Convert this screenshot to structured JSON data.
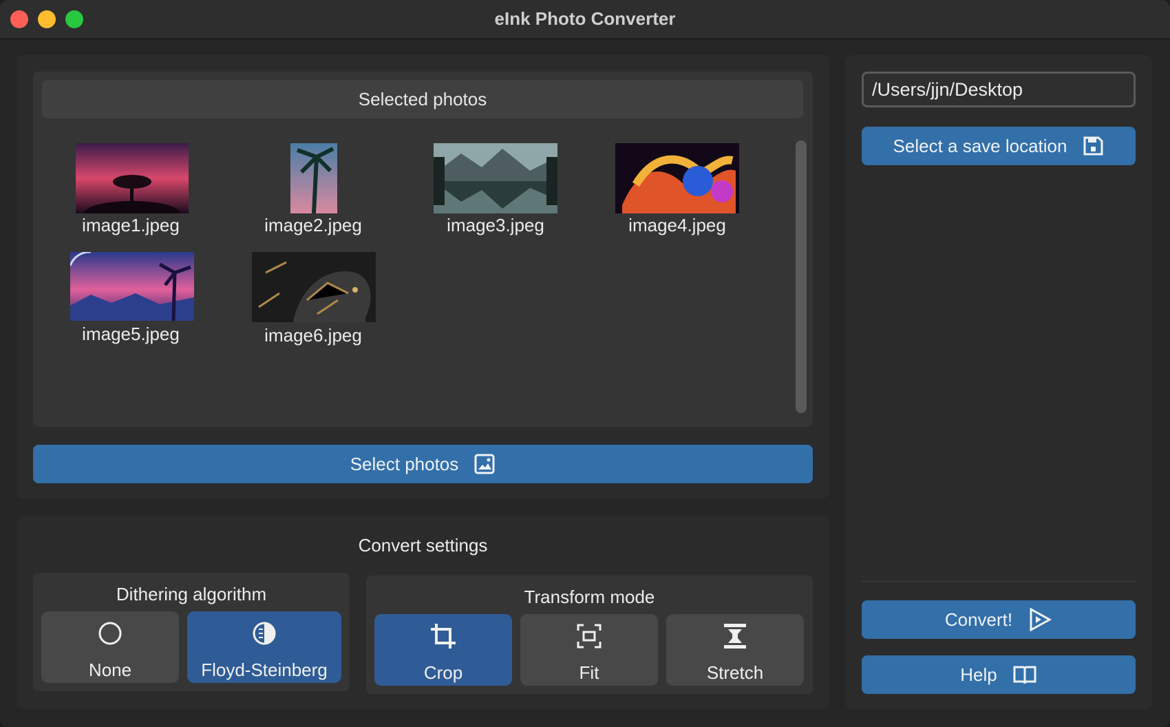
{
  "window": {
    "title": "eInk Photo Converter"
  },
  "photos_panel": {
    "header": "Selected photos",
    "photos": [
      {
        "name": "image1.jpeg"
      },
      {
        "name": "image2.jpeg"
      },
      {
        "name": "image3.jpeg"
      },
      {
        "name": "image4.jpeg"
      },
      {
        "name": "image5.jpeg"
      },
      {
        "name": "image6.jpeg"
      }
    ],
    "select_button": "Select photos"
  },
  "save": {
    "path_value": "/Users/jjn/Desktop",
    "select_button": "Select a save location"
  },
  "convert_settings": {
    "title": "Convert settings",
    "dithering": {
      "title": "Dithering algorithm",
      "options": [
        {
          "label": "None",
          "icon": "circle-icon",
          "selected": false
        },
        {
          "label": "Floyd-Steinberg",
          "icon": "contrast-icon",
          "selected": true
        }
      ]
    },
    "transform": {
      "title": "Transform mode",
      "options": [
        {
          "label": "Crop",
          "icon": "crop-icon",
          "selected": true
        },
        {
          "label": "Fit",
          "icon": "fit-icon",
          "selected": false
        },
        {
          "label": "Stretch",
          "icon": "stretch-icon",
          "selected": false
        }
      ]
    }
  },
  "actions": {
    "convert": "Convert!",
    "help": "Help"
  },
  "colors": {
    "accent": "#336fa9",
    "selected": "#2f5c96",
    "background": "#262626"
  }
}
